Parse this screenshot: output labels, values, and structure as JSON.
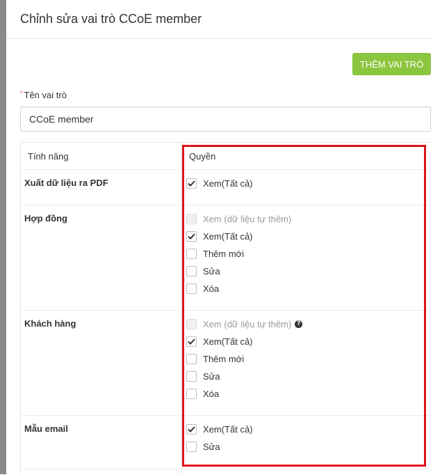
{
  "header": {
    "title": "Chỉnh sửa vai trò CCoE member"
  },
  "toolbar": {
    "add_role_label": "THÊM VAI TRÒ"
  },
  "form": {
    "required_mark": "*",
    "role_name_label": "Tên vai trò",
    "role_name_value": "CCoE member"
  },
  "table": {
    "col_feature": "Tính năng",
    "col_permission": "Quyền",
    "rows": [
      {
        "feature": "Xuất dữ liệu ra PDF",
        "perms": [
          {
            "label": "Xem(Tất cả)",
            "checked": true,
            "disabled": false
          }
        ]
      },
      {
        "feature": "Hợp đồng",
        "perms": [
          {
            "label": "Xem (dữ liệu tự thêm)",
            "checked": false,
            "disabled": true
          },
          {
            "label": "Xem(Tất cả)",
            "checked": true,
            "disabled": false
          },
          {
            "label": "Thêm mới",
            "checked": false,
            "disabled": false
          },
          {
            "label": "Sửa",
            "checked": false,
            "disabled": false
          },
          {
            "label": "Xóa",
            "checked": false,
            "disabled": false
          }
        ]
      },
      {
        "feature": "Khách hàng",
        "perms": [
          {
            "label": "Xem (dữ liệu tự thêm)",
            "checked": false,
            "disabled": true,
            "help": "?"
          },
          {
            "label": "Xem(Tất cả)",
            "checked": true,
            "disabled": false
          },
          {
            "label": "Thêm mới",
            "checked": false,
            "disabled": false
          },
          {
            "label": "Sửa",
            "checked": false,
            "disabled": false
          },
          {
            "label": "Xóa",
            "checked": false,
            "disabled": false
          }
        ]
      },
      {
        "feature": "Mẫu email",
        "perms": [
          {
            "label": "Xem(Tất cả)",
            "checked": true,
            "disabled": false
          },
          {
            "label": "Sửa",
            "checked": false,
            "disabled": false
          }
        ]
      }
    ]
  },
  "colors": {
    "accent_green": "#8cc63f",
    "highlight_red": "#e0141a",
    "required_red": "#e84c3d"
  },
  "icons": {
    "check": "check-icon",
    "help": "question-circle-icon"
  }
}
